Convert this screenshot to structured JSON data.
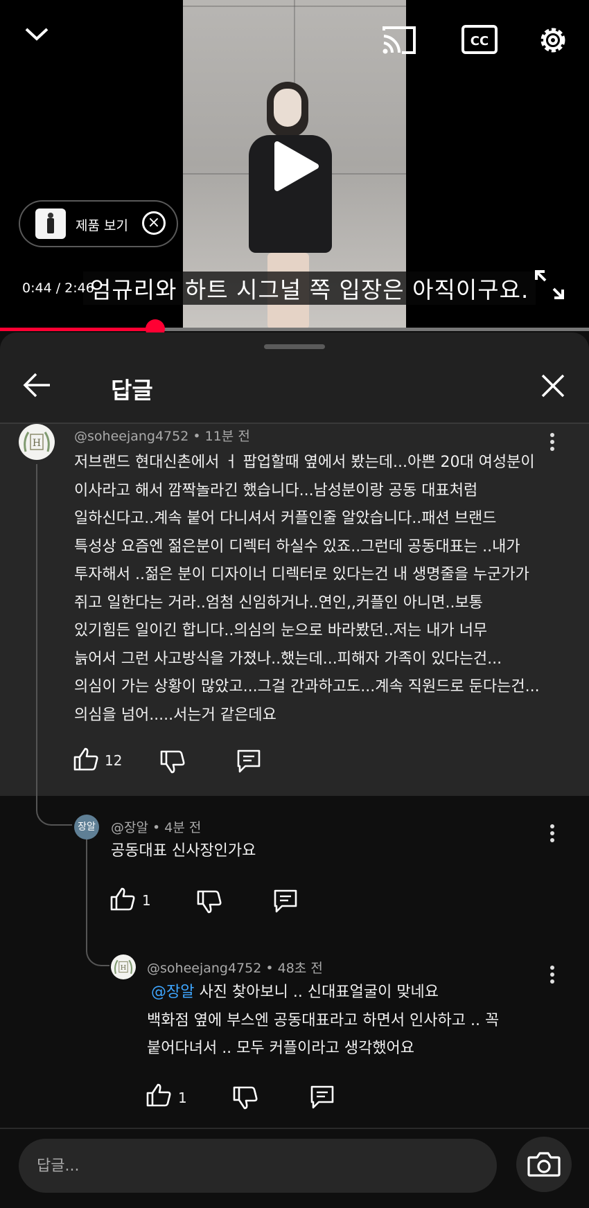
{
  "video": {
    "product_chip_label": "제품 보기",
    "time": "0:44 / 2:46",
    "caption": "엄규리와 하트 시그널 쪽 입장은 아직이구요."
  },
  "panel": {
    "title": "답글"
  },
  "comments": [
    {
      "handle": "@soheejang4752",
      "age": "11분 전",
      "lines": [
        "저브랜드 현대신촌에서 ㅓ 팝업할때 옆에서 봤는데...아쁜 20대 여성분이",
        "이사라고 해서 깜짝놀라긴 했습니다...남성분이랑 공동 대표처럼",
        "일하신다고..계속 붙어 다니셔서 커플인줄 알았습니다..패션 브랜드",
        "특성상 요즘엔 젊은분이 디렉터 하실수 있죠..그런데 공동대표는 ..내가",
        "투자해서 ..젊은 분이 디자이너 디렉터로 있다는건 내 생명줄을 누군가가",
        "쥐고 일한다는 거라..엄첨 신임하거나..연인,,커플인 아니면..보통",
        "있기힘든 일이긴 합니다..의심의 눈으로 바라봤던..저는 내가 너무",
        "늙어서 그런 사고방식을 가졌나..했는데...피해자 가족이 있다는건...",
        "의심이 가는 상황이 많았고...그걸 간과하고도...계속 직원드로 둔다는건...",
        "의심을 넘어.....서는거 같은데요"
      ],
      "likes": "12"
    },
    {
      "avatar_text": "장알",
      "handle": "@장알",
      "age": "4분 전",
      "text": "공동대표 신사장인가요",
      "likes": "1"
    },
    {
      "handle": "@soheejang4752",
      "age": "48초 전",
      "mention": "@장알",
      "line1_rest": " 사진 찾아보니 .. 신대표얼굴이 맞네요",
      "line2": "백화점 옆에 부스엔 공동대표라고 하면서 인사하고 .. 꼭",
      "line3": "붙어다녀서 .. 모두 커플이라고 생각했어요",
      "likes": "1"
    }
  ],
  "reply_box": {
    "placeholder": "답글..."
  },
  "logo_letter": "H",
  "colors": {
    "accent": "#ff0033",
    "mention": "#3ea6ff",
    "avatar_blue": "#5f7f95"
  }
}
